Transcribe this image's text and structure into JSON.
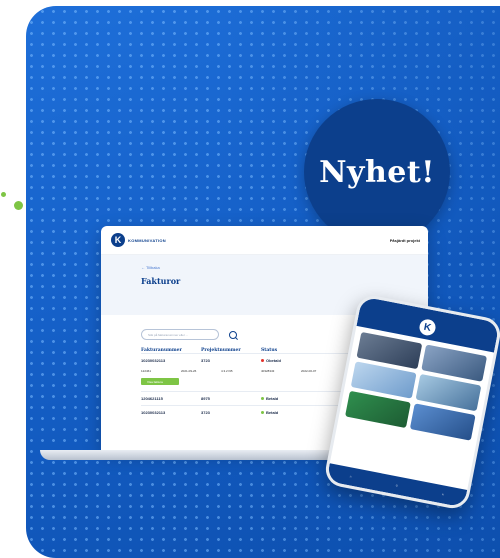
{
  "badge": {
    "text": "Nyhet!"
  },
  "laptop": {
    "brand": "KOMMUNIVATION",
    "menu_label": "Påsjärdt projekt",
    "back_label": "← Tillbaka",
    "page_title": "Fakturor",
    "search_placeholder": "Sök på fakturanummer eller ...",
    "columns": [
      "Fakturanummer",
      "Projektnummer",
      "Status"
    ],
    "rows": [
      {
        "invoice": "10230032113",
        "project": "3723",
        "status": "Obetald",
        "status_color": "#e4322b"
      },
      {
        "invoice": "1204621115",
        "project": "8975",
        "status": "Betald",
        "status_color": "#7ec545"
      },
      {
        "invoice": "10230032113",
        "project": "3723",
        "status": "Betald",
        "status_color": "#7ec545"
      }
    ],
    "detail_values": [
      "122461",
      "2021-09-26",
      "4.3.2 KB",
      "40328343",
      "2022-00-07"
    ],
    "detail_button": "Visa faktura"
  },
  "phone": {
    "logo": "K",
    "cards": [
      "",
      "",
      "",
      "",
      "",
      ""
    ],
    "nav": [
      "",
      "",
      ""
    ]
  },
  "colors": {
    "accent": "#0c3f8c",
    "brand_blue": "#1560c8",
    "green": "#7ec545",
    "red": "#e4322b"
  }
}
